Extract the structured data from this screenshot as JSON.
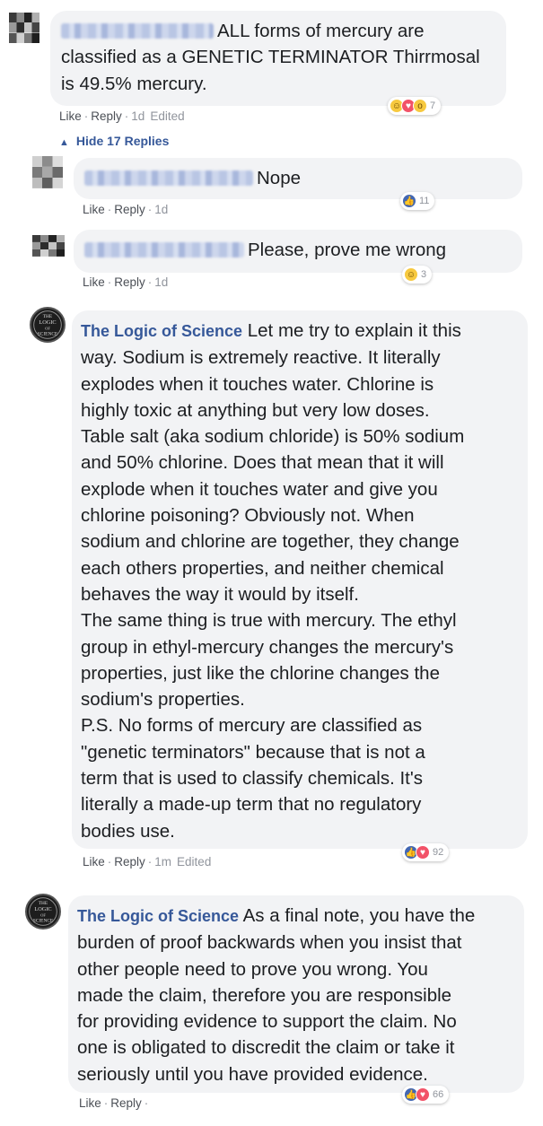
{
  "comment1": {
    "text": "ALL forms of mercury are classified as a GENETIC TERMINATOR Thirrmosal is 49.5% mercury.",
    "reaction_count": "7",
    "actions": {
      "like": "Like",
      "reply": "Reply",
      "time": "1d",
      "edited": "Edited"
    }
  },
  "replies_toggle": {
    "label": "Hide 17 Replies",
    "icon": "chevron-up-icon"
  },
  "reply1": {
    "text": "Nope",
    "reaction_count": "11",
    "actions": {
      "like": "Like",
      "reply": "Reply",
      "time": "1d"
    }
  },
  "reply2": {
    "text": "Please, prove me wrong",
    "reaction_count": "3",
    "actions": {
      "like": "Like",
      "reply": "Reply",
      "time": "1d"
    }
  },
  "reply3": {
    "author": "The Logic of Science",
    "lines": [
      "Let me try to explain it this",
      "way. Sodium is extremely reactive. It literally",
      "explodes when it touches water. Chlorine is",
      "highly toxic at anything but very low doses.",
      "Table salt (aka sodium chloride) is 50% sodium",
      "and 50% chlorine. Does that mean that it will",
      "explode when it touches water and give you",
      "chlorine poisoning? Obviously not. When",
      "sodium and chlorine are together, they change",
      "each others properties, and neither chemical",
      "behaves the way it would by itself.",
      "The same thing is true with mercury. The ethyl",
      "group in ethyl-mercury changes the mercury's",
      "properties, just like the chlorine changes the",
      "sodium's properties.",
      "P.S. No forms of mercury are classified as",
      "\"genetic terminators\" because that is not a",
      "term that is used to classify chemicals. It's",
      "literally a made-up term that no regulatory",
      "bodies use."
    ],
    "reaction_count": "92",
    "actions": {
      "like": "Like",
      "reply": "Reply",
      "time": "1m",
      "edited": "Edited"
    }
  },
  "reply4": {
    "author": "The Logic of Science",
    "lines": [
      "As a final note, you have the",
      "burden of proof backwards when you insist that",
      "other people need to prove you wrong. You",
      "made the claim, therefore you are responsible",
      "for providing evidence to support the claim. No",
      "one is obligated to discredit the claim or take it",
      "seriously until you have provided evidence."
    ],
    "reaction_count": "66",
    "actions": {
      "like": "Like",
      "reply": "Reply"
    }
  },
  "logo_text": [
    "THE",
    "LOGIC",
    "OF",
    "SCIENCE"
  ],
  "colors": {
    "link": "#365899",
    "bubble": "#f2f3f5",
    "like": "#4267b2",
    "love": "#f25268",
    "muted": "#90949c"
  }
}
